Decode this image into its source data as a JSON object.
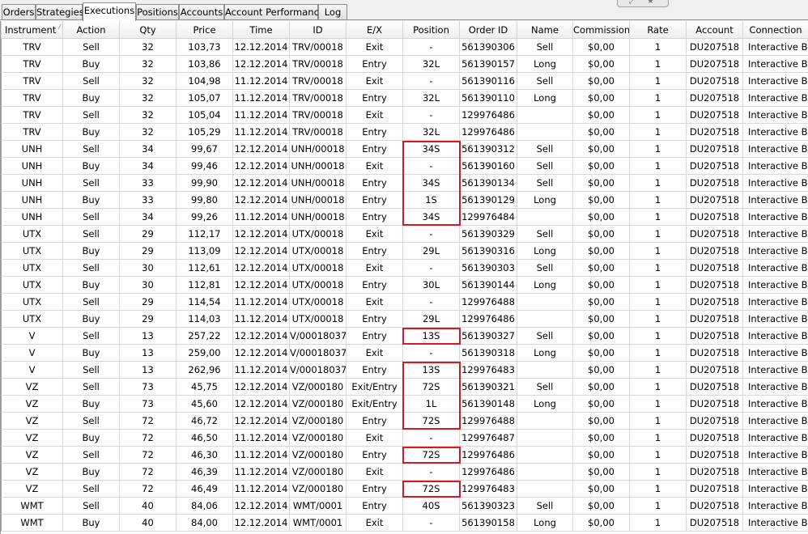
{
  "tabs": [
    {
      "label": "Orders",
      "active": false
    },
    {
      "label": "Strategies",
      "active": false
    },
    {
      "label": "Executions",
      "active": true
    },
    {
      "label": "Positions",
      "active": false
    },
    {
      "label": "Accounts",
      "active": false
    },
    {
      "label": "Account Performance",
      "active": false
    },
    {
      "label": "Log",
      "active": false
    }
  ],
  "columns": [
    "Instrument",
    "Action",
    "Qty",
    "Price",
    "Time",
    "ID",
    "E/X",
    "Position",
    "Order ID",
    "Name",
    "Commission",
    "Rate",
    "Account",
    "Connection"
  ],
  "sort_indicator": "⁄",
  "rows": [
    [
      "TRV",
      "Sell",
      "32",
      "103,73",
      "12.12.2014",
      "TRV/00018",
      "Exit",
      "-",
      "561390306",
      "Sell",
      "$0,00",
      "1",
      "DU207518",
      "Interactive Br"
    ],
    [
      "TRV",
      "Buy",
      "32",
      "103,86",
      "12.12.2014",
      "TRV/00018",
      "Entry",
      "32L",
      "561390157",
      "Long",
      "$0,00",
      "1",
      "DU207518",
      "Interactive Br"
    ],
    [
      "TRV",
      "Sell",
      "32",
      "104,98",
      "11.12.2014",
      "TRV/00018",
      "Exit",
      "-",
      "561390116",
      "Sell",
      "$0,00",
      "1",
      "DU207518",
      "Interactive Br"
    ],
    [
      "TRV",
      "Buy",
      "32",
      "105,07",
      "11.12.2014",
      "TRV/00018",
      "Entry",
      "32L",
      "561390110",
      "Long",
      "$0,00",
      "1",
      "DU207518",
      "Interactive Br"
    ],
    [
      "TRV",
      "Sell",
      "32",
      "105,04",
      "11.12.2014",
      "TRV/00018",
      "Exit",
      "-",
      "129976486",
      "",
      "$0,00",
      "1",
      "DU207518",
      "Interactive Br"
    ],
    [
      "TRV",
      "Buy",
      "32",
      "105,29",
      "11.12.2014",
      "TRV/00018",
      "Entry",
      "32L",
      "129976486",
      "",
      "$0,00",
      "1",
      "DU207518",
      "Interactive Br"
    ],
    [
      "UNH",
      "Sell",
      "34",
      "99,67",
      "12.12.2014",
      "UNH/00018",
      "Entry",
      "34S",
      "561390312",
      "Sell",
      "$0,00",
      "1",
      "DU207518",
      "Interactive Br"
    ],
    [
      "UNH",
      "Buy",
      "34",
      "99,46",
      "12.12.2014",
      "UNH/00018",
      "Exit",
      "-",
      "561390160",
      "Sell",
      "$0,00",
      "1",
      "DU207518",
      "Interactive Br"
    ],
    [
      "UNH",
      "Sell",
      "33",
      "99,90",
      "12.12.2014",
      "UNH/00018",
      "Entry",
      "34S",
      "561390134",
      "Sell",
      "$0,00",
      "1",
      "DU207518",
      "Interactive Br"
    ],
    [
      "UNH",
      "Buy",
      "33",
      "99,80",
      "12.12.2014",
      "UNH/00018",
      "Entry",
      "1S",
      "561390129",
      "Long",
      "$0,00",
      "1",
      "DU207518",
      "Interactive Br"
    ],
    [
      "UNH",
      "Sell",
      "34",
      "99,26",
      "11.12.2014",
      "UNH/00018",
      "Entry",
      "34S",
      "129976484",
      "",
      "$0,00",
      "1",
      "DU207518",
      "Interactive Br"
    ],
    [
      "UTX",
      "Sell",
      "29",
      "112,17",
      "12.12.2014",
      "UTX/00018",
      "Exit",
      "-",
      "561390329",
      "Sell",
      "$0,00",
      "1",
      "DU207518",
      "Interactive Br"
    ],
    [
      "UTX",
      "Buy",
      "29",
      "113,09",
      "12.12.2014",
      "UTX/00018",
      "Entry",
      "29L",
      "561390316",
      "Long",
      "$0,00",
      "1",
      "DU207518",
      "Interactive Br"
    ],
    [
      "UTX",
      "Sell",
      "30",
      "112,61",
      "12.12.2014",
      "UTX/00018",
      "Exit",
      "-",
      "561390303",
      "Sell",
      "$0,00",
      "1",
      "DU207518",
      "Interactive Br"
    ],
    [
      "UTX",
      "Buy",
      "30",
      "112,81",
      "12.12.2014",
      "UTX/00018",
      "Entry",
      "30L",
      "561390144",
      "Long",
      "$0,00",
      "1",
      "DU207518",
      "Interactive Br"
    ],
    [
      "UTX",
      "Sell",
      "29",
      "114,54",
      "11.12.2014",
      "UTX/00018",
      "Exit",
      "-",
      "129976488",
      "",
      "$0,00",
      "1",
      "DU207518",
      "Interactive Br"
    ],
    [
      "UTX",
      "Buy",
      "29",
      "114,03",
      "11.12.2014",
      "UTX/00018",
      "Entry",
      "29L",
      "129976486",
      "",
      "$0,00",
      "1",
      "DU207518",
      "Interactive Br"
    ],
    [
      "V",
      "Sell",
      "13",
      "257,22",
      "12.12.2014",
      "V/00018037",
      "Entry",
      "13S",
      "561390327",
      "Sell",
      "$0,00",
      "1",
      "DU207518",
      "Interactive Br"
    ],
    [
      "V",
      "Buy",
      "13",
      "259,00",
      "12.12.2014",
      "V/00018037",
      "Exit",
      "-",
      "561390318",
      "Long",
      "$0,00",
      "1",
      "DU207518",
      "Interactive Br"
    ],
    [
      "V",
      "Sell",
      "13",
      "262,96",
      "11.12.2014",
      "V/00018037",
      "Entry",
      "13S",
      "129976483",
      "",
      "$0,00",
      "1",
      "DU207518",
      "Interactive Br"
    ],
    [
      "VZ",
      "Sell",
      "73",
      "45,75",
      "12.12.2014",
      "VZ/000180",
      "Exit/Entry",
      "72S",
      "561390321",
      "Sell",
      "$0,00",
      "1",
      "DU207518",
      "Interactive Br"
    ],
    [
      "VZ",
      "Buy",
      "73",
      "45,60",
      "12.12.2014",
      "VZ/000180",
      "Exit/Entry",
      "1L",
      "561390148",
      "Long",
      "$0,00",
      "1",
      "DU207518",
      "Interactive Br"
    ],
    [
      "VZ",
      "Sell",
      "72",
      "46,72",
      "12.12.2014",
      "VZ/000180",
      "Entry",
      "72S",
      "129976488",
      "",
      "$0,00",
      "1",
      "DU207518",
      "Interactive Br"
    ],
    [
      "VZ",
      "Buy",
      "72",
      "46,50",
      "11.12.2014",
      "VZ/000180",
      "Exit",
      "-",
      "129976487",
      "",
      "$0,00",
      "1",
      "DU207518",
      "Interactive Br"
    ],
    [
      "VZ",
      "Sell",
      "72",
      "46,30",
      "11.12.2014",
      "VZ/000180",
      "Entry",
      "72S",
      "129976486",
      "",
      "$0,00",
      "1",
      "DU207518",
      "Interactive Br"
    ],
    [
      "VZ",
      "Buy",
      "72",
      "46,39",
      "11.12.2014",
      "VZ/000180",
      "Exit",
      "-",
      "129976486",
      "",
      "$0,00",
      "1",
      "DU207518",
      "Interactive Br"
    ],
    [
      "VZ",
      "Sell",
      "72",
      "46,49",
      "11.12.2014",
      "VZ/000180",
      "Entry",
      "72S",
      "129976483",
      "",
      "$0,00",
      "1",
      "DU207518",
      "Interactive Br"
    ],
    [
      "WMT",
      "Sell",
      "40",
      "84,06",
      "12.12.2014",
      "WMT/0001",
      "Entry",
      "40S",
      "561390323",
      "Sell",
      "$0,00",
      "1",
      "DU207518",
      "Interactive Br"
    ],
    [
      "WMT",
      "Buy",
      "40",
      "84,00",
      "12.12.2014",
      "WMT/0001",
      "Exit",
      "-",
      "561390158",
      "Long",
      "$0,00",
      "1",
      "DU207518",
      "Interactive Br"
    ]
  ],
  "highlight_color": "#d41a1f",
  "highlight_groups": [
    [
      6,
      10
    ],
    [
      17,
      17
    ],
    [
      19,
      22
    ],
    [
      24,
      24
    ],
    [
      26,
      26
    ]
  ]
}
